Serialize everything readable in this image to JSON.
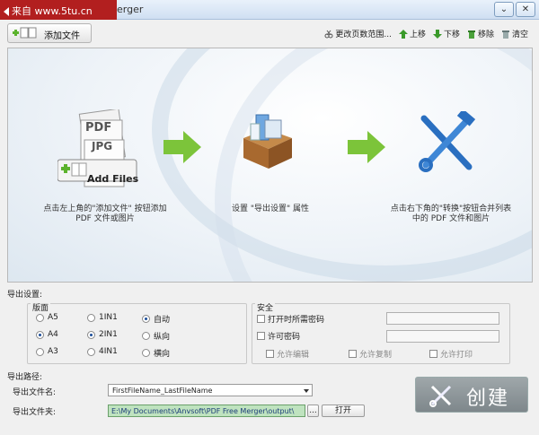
{
  "titlebar": {
    "watermark": "来自 www.5tu.cn",
    "title_fragment": "erger",
    "btn_min": "⌄",
    "btn_close": "✕"
  },
  "toolbar": {
    "add_label": "添加文件",
    "page_range": "更改页数范围...",
    "move_up": "上移",
    "move_down": "下移",
    "remove": "移除",
    "clear": "清空"
  },
  "steps": {
    "step1_badge": "Add Files",
    "step1_doc1": "PDF",
    "step1_doc2": "JPG",
    "step1_text1": "点击左上角的\"添加文件\" 按钮添加",
    "step1_text2": "PDF 文件或图片",
    "step2_text": "设置 \"导出设置\" 属性",
    "step3_text1": "点击右下角的\"转换\"按钮合并列表",
    "step3_text2": "中的 PDF 文件和图片"
  },
  "export": {
    "label": "导出设置:",
    "page_group": "版面",
    "paper": [
      "A5",
      "A4",
      "A3"
    ],
    "nup": [
      "1IN1",
      "2IN1",
      "4IN1"
    ],
    "orient": [
      "自动",
      "纵向",
      "横向"
    ],
    "security": "安全",
    "open_pw": "打开时所需密码",
    "perm_pw": "许可密码",
    "allow_edit": "允许编辑",
    "allow_copy": "允许复制",
    "allow_print": "允许打印"
  },
  "output": {
    "label": "导出路径:",
    "filename_label": "导出文件名:",
    "filename_value": "FirstFileName_LastFileName",
    "folder_label": "导出文件夹:",
    "folder_value": "E:\\My Documents\\Anvsoft\\PDF Free Merger\\output\\",
    "browse": "...",
    "open": "打开",
    "create": "创建"
  },
  "colors": {
    "accent_green": "#5cb32d",
    "watermark_red": "#b21f1f"
  }
}
